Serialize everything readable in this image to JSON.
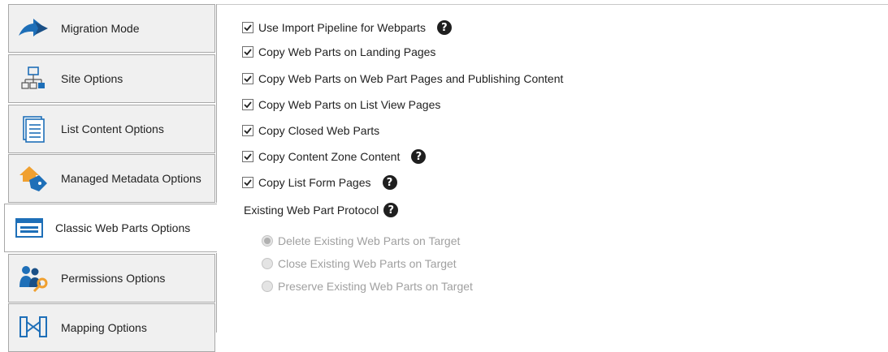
{
  "tabs": [
    {
      "label": "Migration Mode",
      "icon": "arrow-icon"
    },
    {
      "label": "Site Options",
      "icon": "sitemap-icon"
    },
    {
      "label": "List Content Options",
      "icon": "list-document-icon"
    },
    {
      "label": "Managed Metadata Options",
      "icon": "tag-icon"
    },
    {
      "label": "Classic Web Parts Options",
      "icon": "web-parts-icon",
      "active": true
    },
    {
      "label": "Permissions Options",
      "icon": "users-key-icon"
    },
    {
      "label": "Mapping Options",
      "icon": "mapping-icon"
    }
  ],
  "checkboxes": [
    {
      "label": "Use Import Pipeline for Webparts",
      "checked": true,
      "help": true
    },
    {
      "label": "Copy Web Parts on Landing Pages",
      "checked": true,
      "help": false
    },
    {
      "label": "Copy Web Parts on Web Part Pages and Publishing Content",
      "checked": true,
      "help": false
    },
    {
      "label": "Copy Web Parts on List View Pages",
      "checked": true,
      "help": false
    },
    {
      "label": "Copy Closed Web Parts",
      "checked": true,
      "help": false
    },
    {
      "label": "Copy Content Zone Content",
      "checked": true,
      "help": true
    },
    {
      "label": "Copy List Form Pages",
      "checked": true,
      "help": true
    }
  ],
  "protocol": {
    "label": "Existing Web Part Protocol",
    "options": [
      {
        "label": "Delete Existing Web Parts on Target",
        "selected": true,
        "disabled": true
      },
      {
        "label": "Close Existing Web Parts on Target",
        "selected": false,
        "disabled": true
      },
      {
        "label": "Preserve Existing Web Parts on Target",
        "selected": false,
        "disabled": true
      }
    ]
  },
  "help_glyph": "?",
  "colors": {
    "accent_blue": "#1e6fb8",
    "accent_orange": "#f0a030",
    "tab_bg": "#f0f0f0",
    "disabled_text": "#a0a0a0"
  }
}
